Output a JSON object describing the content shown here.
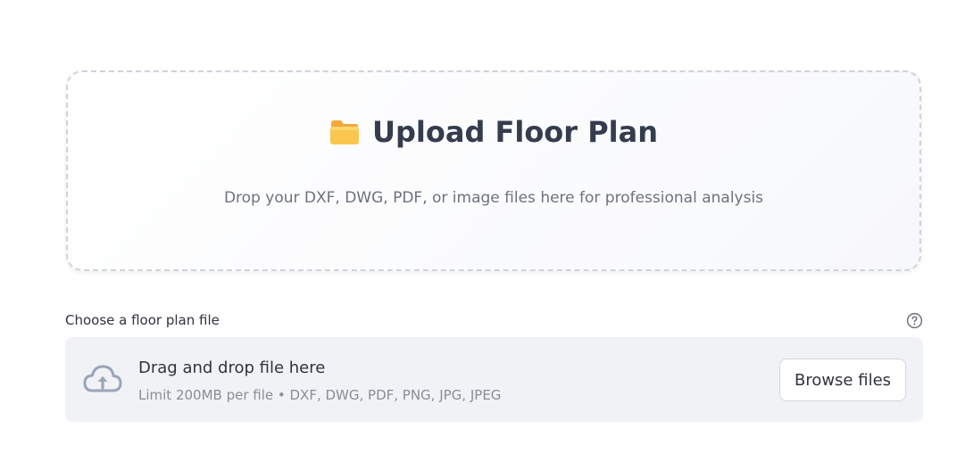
{
  "upload_card": {
    "icon": "folder-icon",
    "title": "Upload Floor Plan",
    "subtitle": "Drop your DXF, DWG, PDF, or image files here for professional analysis"
  },
  "uploader": {
    "label": "Choose a floor plan file",
    "help_icon": "question-circle-icon",
    "dropzone_icon": "cloud-upload-icon",
    "dropzone_title": "Drag and drop file here",
    "dropzone_limit": "Limit 200MB per file • DXF, DWG, PDF, PNG, JPG, JPEG",
    "browse_label": "Browse files"
  },
  "colors": {
    "title": "#353c4e",
    "subtitle": "#6b7280",
    "dropzone_bg": "#f0f2f6",
    "folder": "#f7b731"
  }
}
